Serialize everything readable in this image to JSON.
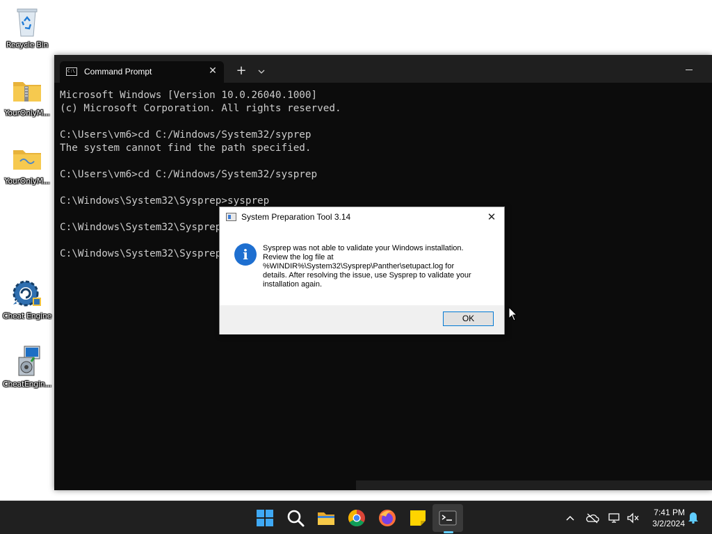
{
  "desktop": {
    "icons": [
      {
        "label": "Recycle Bin",
        "icon": "recycle-bin-icon"
      },
      {
        "label": "YourOnlyM...",
        "icon": "zip-folder-icon"
      },
      {
        "label": "YourOnlyM...",
        "icon": "folder-icon"
      },
      {
        "label": "Cheat Engine",
        "icon": "cheat-engine-icon"
      },
      {
        "label": "CheatEngin...",
        "icon": "installer-icon"
      }
    ]
  },
  "terminal": {
    "tab_title": "Command Prompt",
    "tab_icon_text": "C:\\",
    "new_tab": "+",
    "dropdown": "⌄",
    "close": "✕",
    "minimize": "—",
    "lines": [
      "Microsoft Windows [Version 10.0.26040.1000]",
      "(c) Microsoft Corporation. All rights reserved.",
      "",
      "C:\\Users\\vm6>cd C:/Windows/System32/syprep",
      "The system cannot find the path specified.",
      "",
      "C:\\Users\\vm6>cd C:/Windows/System32/sysprep",
      "",
      "C:\\Windows\\System32\\Sysprep>sysprep",
      "",
      "C:\\Windows\\System32\\Sysprep>",
      "",
      "C:\\Windows\\System32\\Sysprep>"
    ]
  },
  "dialog": {
    "title": "System Preparation Tool 3.14",
    "close": "✕",
    "info_glyph": "i",
    "message_lines": [
      "Sysprep was not able to validate your Windows installation.",
      "Review the log file at",
      "%WINDIR%\\System32\\Sysprep\\Panther\\setupact.log for",
      "details. After resolving the issue, use Sysprep to validate your",
      "installation again."
    ],
    "ok_label": "OK"
  },
  "taskbar": {
    "apps": [
      "start-icon",
      "search-icon",
      "file-explorer-icon",
      "chrome-icon",
      "firefox-icon",
      "sticky-notes-icon",
      "terminal-icon"
    ],
    "tray": {
      "chevron": "^",
      "time": "7:41 PM",
      "date": "3/2/2024"
    },
    "colors": {
      "accent": "#60cdff",
      "background": "#202020"
    }
  }
}
